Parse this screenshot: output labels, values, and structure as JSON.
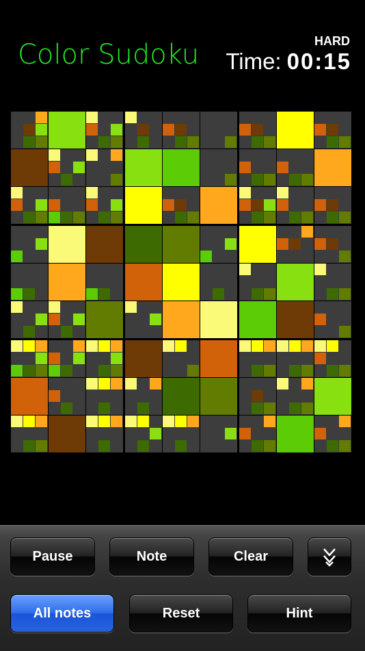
{
  "header": {
    "title": "Color Sudoku",
    "difficulty": "HARD",
    "time_label": "Time:",
    "time_value": "00:15"
  },
  "colors": {
    "background": "#000000",
    "cell_empty": "#3d3d3d",
    "title": "#22ee22",
    "button_active": "#2f6fe8",
    "palette": [
      "#fafa78",
      "#ffff00",
      "#ffa81e",
      "#d2620a",
      "#6e3a06",
      "#88e010",
      "#5ccc06",
      "#3e6a02",
      "#627c02"
    ]
  },
  "board": {
    "size": 9,
    "cells": [
      {
        "value": 0,
        "notes": [
          3,
          5,
          6,
          8,
          9
        ]
      },
      {
        "value": 6,
        "notes": []
      },
      {
        "value": 0,
        "notes": [
          1,
          4,
          6,
          8,
          9
        ]
      },
      {
        "value": 0,
        "notes": [
          1,
          5,
          8
        ]
      },
      {
        "value": 0,
        "notes": [
          4,
          5,
          8,
          9
        ]
      },
      {
        "value": 0,
        "notes": [
          9
        ]
      },
      {
        "value": 0,
        "notes": [
          4,
          5,
          8,
          9
        ]
      },
      {
        "value": 2,
        "notes": []
      },
      {
        "value": 0,
        "notes": [
          4,
          5,
          8,
          9
        ]
      },
      {
        "value": 5,
        "notes": []
      },
      {
        "value": 0,
        "notes": [
          1,
          4,
          6,
          8
        ]
      },
      {
        "value": 0,
        "notes": [
          1,
          3,
          9
        ]
      },
      {
        "value": 6,
        "notes": []
      },
      {
        "value": 7,
        "notes": []
      },
      {
        "value": 0,
        "notes": [
          9
        ]
      },
      {
        "value": 0,
        "notes": [
          4,
          8,
          9
        ]
      },
      {
        "value": 0,
        "notes": [
          4,
          8,
          9
        ]
      },
      {
        "value": 3,
        "notes": []
      },
      {
        "value": 0,
        "notes": [
          1,
          4,
          6,
          8,
          9
        ]
      },
      {
        "value": 0,
        "notes": [
          4,
          7,
          8,
          9
        ]
      },
      {
        "value": 0,
        "notes": [
          1,
          4,
          6,
          8,
          9
        ]
      },
      {
        "value": 2,
        "notes": []
      },
      {
        "value": 0,
        "notes": [
          4,
          5,
          8,
          9
        ]
      },
      {
        "value": 3,
        "notes": []
      },
      {
        "value": 0,
        "notes": [
          1,
          4,
          5,
          6,
          8,
          9
        ]
      },
      {
        "value": 0,
        "notes": [
          1,
          4,
          8,
          9
        ]
      },
      {
        "value": 0,
        "notes": [
          4,
          5,
          8,
          9
        ]
      },
      {
        "value": 0,
        "notes": [
          6,
          7
        ]
      },
      {
        "value": 1,
        "notes": []
      },
      {
        "value": 5,
        "notes": []
      },
      {
        "value": 8,
        "notes": []
      },
      {
        "value": 9,
        "notes": []
      },
      {
        "value": 0,
        "notes": [
          6,
          7
        ]
      },
      {
        "value": 2,
        "notes": []
      },
      {
        "value": 0,
        "notes": [
          3,
          4,
          5
        ]
      },
      {
        "value": 0,
        "notes": [
          4,
          5,
          9
        ]
      },
      {
        "value": 0,
        "notes": [
          7,
          8
        ]
      },
      {
        "value": 3,
        "notes": []
      },
      {
        "value": 0,
        "notes": [
          7,
          8
        ]
      },
      {
        "value": 4,
        "notes": []
      },
      {
        "value": 2,
        "notes": []
      },
      {
        "value": 0,
        "notes": [
          8
        ]
      },
      {
        "value": 0,
        "notes": [
          1,
          8,
          9
        ]
      },
      {
        "value": 6,
        "notes": []
      },
      {
        "value": 0,
        "notes": [
          1,
          8,
          9
        ]
      },
      {
        "value": 0,
        "notes": [
          1,
          6,
          8
        ]
      },
      {
        "value": 0,
        "notes": [
          1,
          4,
          6,
          8
        ]
      },
      {
        "value": 9,
        "notes": []
      },
      {
        "value": 0,
        "notes": [
          1,
          6
        ]
      },
      {
        "value": 3,
        "notes": []
      },
      {
        "value": 1,
        "notes": []
      },
      {
        "value": 7,
        "notes": []
      },
      {
        "value": 5,
        "notes": []
      },
      {
        "value": 0,
        "notes": [
          4,
          9
        ]
      },
      {
        "value": 0,
        "notes": [
          1,
          2,
          3,
          6,
          7,
          8,
          9
        ]
      },
      {
        "value": 0,
        "notes": [
          3,
          4,
          6,
          7,
          8
        ]
      },
      {
        "value": 0,
        "notes": [
          1,
          2,
          3,
          6,
          8,
          9
        ]
      },
      {
        "value": 5,
        "notes": []
      },
      {
        "value": 0,
        "notes": [
          1,
          2,
          9
        ]
      },
      {
        "value": 4,
        "notes": []
      },
      {
        "value": 0,
        "notes": [
          1,
          2,
          3,
          8,
          9
        ]
      },
      {
        "value": 0,
        "notes": [
          1,
          2,
          3,
          8,
          9
        ]
      },
      {
        "value": 0,
        "notes": [
          1,
          2,
          4,
          8,
          9
        ]
      },
      {
        "value": 4,
        "notes": []
      },
      {
        "value": 0,
        "notes": [
          4,
          8
        ]
      },
      {
        "value": 0,
        "notes": [
          1,
          2,
          3,
          8
        ]
      },
      {
        "value": 0,
        "notes": [
          1,
          3,
          8
        ]
      },
      {
        "value": 8,
        "notes": []
      },
      {
        "value": 9,
        "notes": []
      },
      {
        "value": 0,
        "notes": [
          5,
          8,
          9
        ]
      },
      {
        "value": 0,
        "notes": [
          1,
          3,
          8,
          9
        ]
      },
      {
        "value": 6,
        "notes": []
      },
      {
        "value": 0,
        "notes": [
          1,
          2,
          3,
          8,
          9
        ]
      },
      {
        "value": 5,
        "notes": []
      },
      {
        "value": 0,
        "notes": [
          1,
          2,
          3,
          8
        ]
      },
      {
        "value": 0,
        "notes": [
          1,
          2,
          6,
          8
        ]
      },
      {
        "value": 0,
        "notes": [
          1,
          2,
          3,
          8
        ]
      },
      {
        "value": 0,
        "notes": [
          6
        ]
      },
      {
        "value": 0,
        "notes": [
          3,
          4,
          8,
          9
        ]
      },
      {
        "value": 7,
        "notes": []
      },
      {
        "value": 0,
        "notes": [
          3,
          4,
          8,
          9
        ]
      }
    ]
  },
  "toolbar": {
    "pause_label": "Pause",
    "note_label": "Note",
    "clear_label": "Clear",
    "collapse_icon": "double-chevron-down-icon",
    "all_notes_label": "All notes",
    "reset_label": "Reset",
    "hint_label": "Hint",
    "active": "all_notes"
  }
}
